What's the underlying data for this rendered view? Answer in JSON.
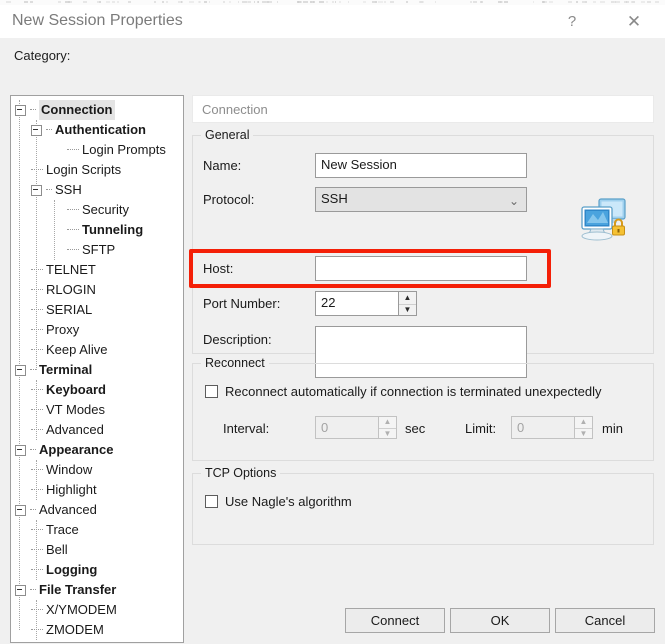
{
  "window": {
    "title": "New Session Properties",
    "help_icon": "?",
    "close_icon": "✕"
  },
  "category_label": "Category:",
  "tree": {
    "items": [
      {
        "label": "Connection",
        "indent": 0,
        "kind": "expander",
        "bold": true,
        "selected": true
      },
      {
        "label": "Authentication",
        "indent": 1,
        "kind": "expander",
        "bold": true,
        "selected": false
      },
      {
        "label": "Login Prompts",
        "indent": 3,
        "kind": "leaf",
        "bold": false,
        "selected": false
      },
      {
        "label": "Login Scripts",
        "indent": 1,
        "kind": "leaf",
        "bold": false,
        "selected": false
      },
      {
        "label": "SSH",
        "indent": 1,
        "kind": "expander",
        "bold": false,
        "selected": false
      },
      {
        "label": "Security",
        "indent": 3,
        "kind": "leaf",
        "bold": false,
        "selected": false
      },
      {
        "label": "Tunneling",
        "indent": 3,
        "kind": "leaf",
        "bold": true,
        "selected": false
      },
      {
        "label": "SFTP",
        "indent": 3,
        "kind": "leaf",
        "bold": false,
        "selected": false
      },
      {
        "label": "TELNET",
        "indent": 1,
        "kind": "leaf",
        "bold": false,
        "selected": false
      },
      {
        "label": "RLOGIN",
        "indent": 1,
        "kind": "leaf",
        "bold": false,
        "selected": false
      },
      {
        "label": "SERIAL",
        "indent": 1,
        "kind": "leaf",
        "bold": false,
        "selected": false
      },
      {
        "label": "Proxy",
        "indent": 1,
        "kind": "leaf",
        "bold": false,
        "selected": false
      },
      {
        "label": "Keep Alive",
        "indent": 1,
        "kind": "leaf",
        "bold": false,
        "selected": false
      },
      {
        "label": "Terminal",
        "indent": 0,
        "kind": "expander",
        "bold": true,
        "selected": false
      },
      {
        "label": "Keyboard",
        "indent": 1,
        "kind": "leaf",
        "bold": true,
        "selected": false
      },
      {
        "label": "VT Modes",
        "indent": 1,
        "kind": "leaf",
        "bold": false,
        "selected": false
      },
      {
        "label": "Advanced",
        "indent": 1,
        "kind": "leaf",
        "bold": false,
        "selected": false
      },
      {
        "label": "Appearance",
        "indent": 0,
        "kind": "expander",
        "bold": true,
        "selected": false
      },
      {
        "label": "Window",
        "indent": 1,
        "kind": "leaf",
        "bold": false,
        "selected": false
      },
      {
        "label": "Highlight",
        "indent": 1,
        "kind": "leaf",
        "bold": false,
        "selected": false
      },
      {
        "label": "Advanced",
        "indent": 0,
        "kind": "expander",
        "bold": false,
        "selected": false
      },
      {
        "label": "Trace",
        "indent": 1,
        "kind": "leaf",
        "bold": false,
        "selected": false
      },
      {
        "label": "Bell",
        "indent": 1,
        "kind": "leaf",
        "bold": false,
        "selected": false
      },
      {
        "label": "Logging",
        "indent": 1,
        "kind": "leaf",
        "bold": true,
        "selected": false
      },
      {
        "label": "File Transfer",
        "indent": 0,
        "kind": "expander",
        "bold": true,
        "selected": false
      },
      {
        "label": "X/YMODEM",
        "indent": 1,
        "kind": "leaf",
        "bold": false,
        "selected": false
      },
      {
        "label": "ZMODEM",
        "indent": 1,
        "kind": "leaf",
        "bold": false,
        "selected": false
      }
    ]
  },
  "page": {
    "header": "Connection",
    "general": {
      "title": "General",
      "name_label": "Name:",
      "name_value": "New Session",
      "protocol_label": "Protocol:",
      "protocol_value": "SSH",
      "protocol_chevron": "⌄",
      "host_label": "Host:",
      "host_value": "",
      "port_label": "Port Number:",
      "port_value": "22",
      "description_label": "Description:",
      "description_value": "",
      "icon": "secure-computer-icon",
      "spin_up": "▲",
      "spin_down": "▼",
      "scroll_up": "⌃",
      "scroll_down": "⌄"
    },
    "reconnect": {
      "title": "Reconnect",
      "auto_label": "Reconnect automatically if connection is terminated unexpectedly",
      "auto_checked": false,
      "interval_label": "Interval:",
      "interval_value": "0",
      "interval_unit": "sec",
      "limit_label": "Limit:",
      "limit_value": "0",
      "limit_unit": "min"
    },
    "tcp": {
      "title": "TCP Options",
      "nagle_label": "Use Nagle's algorithm",
      "nagle_checked": false
    }
  },
  "footer": {
    "connect": "Connect",
    "ok": "OK",
    "cancel": "Cancel"
  },
  "colors": {
    "highlight_red": "#f41f07",
    "dialog_bg": "#f0f0f0",
    "selection_gray": "#e4e4e4"
  }
}
